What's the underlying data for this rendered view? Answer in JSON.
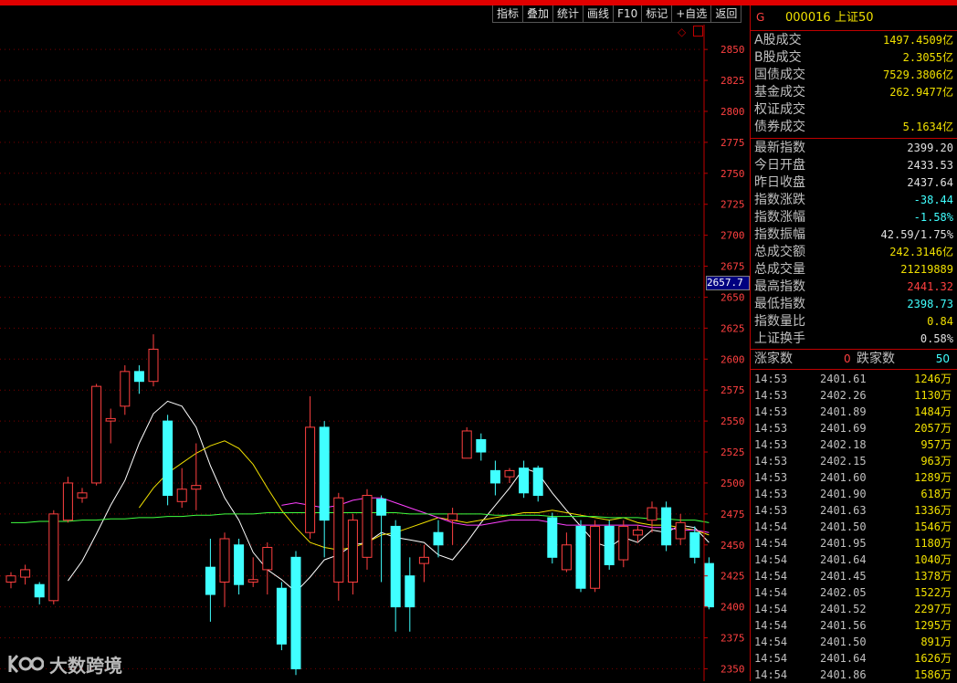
{
  "toolbar": [
    "指标",
    "叠加",
    "统计",
    "画线",
    "F10",
    "标记",
    "+自选",
    "返回"
  ],
  "panel": {
    "icon_letter": "G",
    "code": "000016",
    "name": "上证50",
    "turnover": [
      {
        "label": "A股成交",
        "value": "1497.4509亿"
      },
      {
        "label": "B股成交",
        "value": "2.3055亿"
      },
      {
        "label": "国债成交",
        "value": "7529.3806亿"
      },
      {
        "label": "基金成交",
        "value": "262.9477亿"
      },
      {
        "label": "权证成交",
        "value": ""
      },
      {
        "label": "债券成交",
        "value": "5.1634亿"
      }
    ],
    "stats": [
      {
        "label": "最新指数",
        "value": "2399.20",
        "color": "#e0e0e0"
      },
      {
        "label": "今日开盘",
        "value": "2433.53",
        "color": "#e0e0e0"
      },
      {
        "label": "昨日收盘",
        "value": "2437.64",
        "color": "#e0e0e0"
      },
      {
        "label": "指数涨跌",
        "value": "-38.44",
        "color": "#40ffff"
      },
      {
        "label": "指数涨幅",
        "value": "-1.58%",
        "color": "#40ffff"
      },
      {
        "label": "指数振幅",
        "value": "42.59/1.75%",
        "color": "#e0e0e0"
      },
      {
        "label": "总成交额",
        "value": "242.3146亿",
        "color": "#f0e000"
      },
      {
        "label": "总成交量",
        "value": "21219889",
        "color": "#f0e000"
      },
      {
        "label": "最高指数",
        "value": "2441.32",
        "color": "#ff4040"
      },
      {
        "label": "最低指数",
        "value": "2398.73",
        "color": "#40ffff"
      },
      {
        "label": "指数量比",
        "value": "0.84",
        "color": "#f0e000"
      },
      {
        "label": "上证换手",
        "value": "0.58%",
        "color": "#e0e0e0"
      }
    ],
    "updown": {
      "up_label": "涨家数",
      "up_value": "0",
      "down_label": "跌家数",
      "down_value": "50"
    },
    "ticks": [
      {
        "time": "14:53",
        "price": "2401.61",
        "vol": "1246万"
      },
      {
        "time": "14:53",
        "price": "2402.26",
        "vol": "1130万"
      },
      {
        "time": "14:53",
        "price": "2401.89",
        "vol": "1484万"
      },
      {
        "time": "14:53",
        "price": "2401.69",
        "vol": "2057万"
      },
      {
        "time": "14:53",
        "price": "2402.18",
        "vol": "957万"
      },
      {
        "time": "14:53",
        "price": "2402.15",
        "vol": "963万"
      },
      {
        "time": "14:53",
        "price": "2401.60",
        "vol": "1289万"
      },
      {
        "time": "14:53",
        "price": "2401.90",
        "vol": "618万"
      },
      {
        "time": "14:53",
        "price": "2401.63",
        "vol": "1336万"
      },
      {
        "time": "14:54",
        "price": "2401.50",
        "vol": "1546万"
      },
      {
        "time": "14:54",
        "price": "2401.95",
        "vol": "1180万"
      },
      {
        "time": "14:54",
        "price": "2401.64",
        "vol": "1040万"
      },
      {
        "time": "14:54",
        "price": "2401.45",
        "vol": "1378万"
      },
      {
        "time": "14:54",
        "price": "2402.05",
        "vol": "1522万"
      },
      {
        "time": "14:54",
        "price": "2401.52",
        "vol": "2297万"
      },
      {
        "time": "14:54",
        "price": "2401.56",
        "vol": "1295万"
      },
      {
        "time": "14:54",
        "price": "2401.50",
        "vol": "891万"
      },
      {
        "time": "14:54",
        "price": "2401.64",
        "vol": "1626万"
      },
      {
        "time": "14:54",
        "price": "2401.86",
        "vol": "1586万"
      }
    ]
  },
  "chart_data": {
    "type": "candlestick",
    "ylim": [
      2340,
      2870
    ],
    "yticks": [
      2350,
      2375,
      2400,
      2425,
      2450,
      2475,
      2500,
      2525,
      2550,
      2575,
      2600,
      2625,
      2650,
      2675,
      2700,
      2725,
      2750,
      2775,
      2800,
      2825,
      2850
    ],
    "crosshair_label": "2657.7",
    "up_color": "#ff4040",
    "down_color": "#40ffff",
    "candles": [
      [
        2420,
        2425,
        2428,
        2415
      ],
      [
        2424,
        2430,
        2434,
        2418
      ],
      [
        2418,
        2408,
        2420,
        2402
      ],
      [
        2405,
        2475,
        2478,
        2402
      ],
      [
        2470,
        2500,
        2505,
        2468
      ],
      [
        2488,
        2492,
        2496,
        2484
      ],
      [
        2500,
        2578,
        2580,
        2498
      ],
      [
        2550,
        2552,
        2560,
        2532
      ],
      [
        2562,
        2590,
        2595,
        2555
      ],
      [
        2590,
        2582,
        2595,
        2572
      ],
      [
        2582,
        2608,
        2620,
        2578
      ],
      [
        2550,
        2490,
        2555,
        2482
      ],
      [
        2485,
        2495,
        2512,
        2480
      ],
      [
        2495,
        2498,
        2532,
        2478
      ],
      [
        2432,
        2410,
        2455,
        2388
      ],
      [
        2420,
        2455,
        2460,
        2400
      ],
      [
        2450,
        2418,
        2455,
        2410
      ],
      [
        2420,
        2422,
        2440,
        2416
      ],
      [
        2430,
        2448,
        2452,
        2410
      ],
      [
        2415,
        2370,
        2420,
        2365
      ],
      [
        2440,
        2350,
        2445,
        2345
      ],
      [
        2460,
        2545,
        2570,
        2455
      ],
      [
        2545,
        2470,
        2550,
        2440
      ],
      [
        2420,
        2488,
        2492,
        2405
      ],
      [
        2420,
        2470,
        2475,
        2410
      ],
      [
        2440,
        2490,
        2495,
        2430
      ],
      [
        2487,
        2474,
        2490,
        2420
      ],
      [
        2465,
        2400,
        2470,
        2380
      ],
      [
        2425,
        2400,
        2440,
        2380
      ],
      [
        2435,
        2440,
        2450,
        2420
      ],
      [
        2460,
        2450,
        2470,
        2440
      ],
      [
        2470,
        2475,
        2480,
        2450
      ],
      [
        2520,
        2542,
        2545,
        2520
      ],
      [
        2535,
        2525,
        2540,
        2518
      ],
      [
        2510,
        2500,
        2518,
        2490
      ],
      [
        2505,
        2510,
        2512,
        2500
      ],
      [
        2512,
        2492,
        2518,
        2488
      ],
      [
        2512,
        2490,
        2514,
        2485
      ],
      [
        2472,
        2440,
        2476,
        2435
      ],
      [
        2430,
        2450,
        2460,
        2428
      ],
      [
        2465,
        2415,
        2470,
        2412
      ],
      [
        2415,
        2465,
        2470,
        2412
      ],
      [
        2465,
        2434,
        2470,
        2430
      ],
      [
        2438,
        2465,
        2470,
        2432
      ],
      [
        2458,
        2462,
        2466,
        2452
      ],
      [
        2470,
        2480,
        2485,
        2460
      ],
      [
        2480,
        2450,
        2485,
        2445
      ],
      [
        2455,
        2468,
        2475,
        2450
      ],
      [
        2460,
        2440,
        2465,
        2435
      ],
      [
        2435,
        2400,
        2440,
        2398
      ]
    ],
    "ma_series": [
      {
        "color": "#ffffff",
        "values": [
          null,
          null,
          null,
          null,
          2421,
          2437,
          2459,
          2482,
          2502,
          2532,
          2556,
          2566,
          2562,
          2545,
          2514,
          2488,
          2470,
          2444,
          2430,
          2422,
          2412,
          2424,
          2438,
          2442,
          2450,
          2452,
          2460,
          2456,
          2454,
          2452,
          2442,
          2438,
          2452,
          2468,
          2482,
          2496,
          2512,
          2508,
          2492,
          2478,
          2465,
          2452,
          2448,
          2456,
          2452,
          2462,
          2460,
          2466,
          2464,
          2452
        ]
      },
      {
        "color": "#f0e000",
        "values": [
          null,
          null,
          null,
          null,
          null,
          null,
          null,
          null,
          null,
          2480,
          2496,
          2508,
          2516,
          2524,
          2530,
          2534,
          2528,
          2515,
          2496,
          2478,
          2464,
          2452,
          2448,
          2446,
          2448,
          2452,
          2458,
          2460,
          2464,
          2468,
          2472,
          2470,
          2468,
          2470,
          2472,
          2474,
          2476,
          2476,
          2478,
          2476,
          2474,
          2472,
          2470,
          2472,
          2468,
          2466,
          2466,
          2464,
          2462,
          2458
        ]
      },
      {
        "color": "#ff40ff",
        "values": [
          null,
          null,
          null,
          null,
          null,
          null,
          null,
          null,
          null,
          null,
          null,
          null,
          null,
          null,
          null,
          null,
          null,
          null,
          null,
          2482,
          2484,
          2482,
          2480,
          2482,
          2486,
          2488,
          2488,
          2484,
          2480,
          2476,
          2472,
          2468,
          2466,
          2466,
          2468,
          2470,
          2470,
          2470,
          2468,
          2466,
          2466,
          2466,
          2466,
          2466,
          2466,
          2464,
          2464,
          2462,
          2462,
          2460
        ]
      },
      {
        "color": "#40ff40",
        "values": [
          2468,
          2468,
          2469,
          2469,
          2469,
          2470,
          2470,
          2471,
          2471,
          2472,
          2472,
          2473,
          2473,
          2474,
          2474,
          2475,
          2475,
          2475,
          2476,
          2476,
          2476,
          2476,
          2476,
          2476,
          2476,
          2476,
          2476,
          2476,
          2475,
          2475,
          2475,
          2475,
          2475,
          2475,
          2474,
          2474,
          2474,
          2474,
          2473,
          2473,
          2473,
          2473,
          2472,
          2472,
          2472,
          2471,
          2471,
          2470,
          2470,
          2468
        ]
      }
    ]
  },
  "watermark": "大数跨境"
}
